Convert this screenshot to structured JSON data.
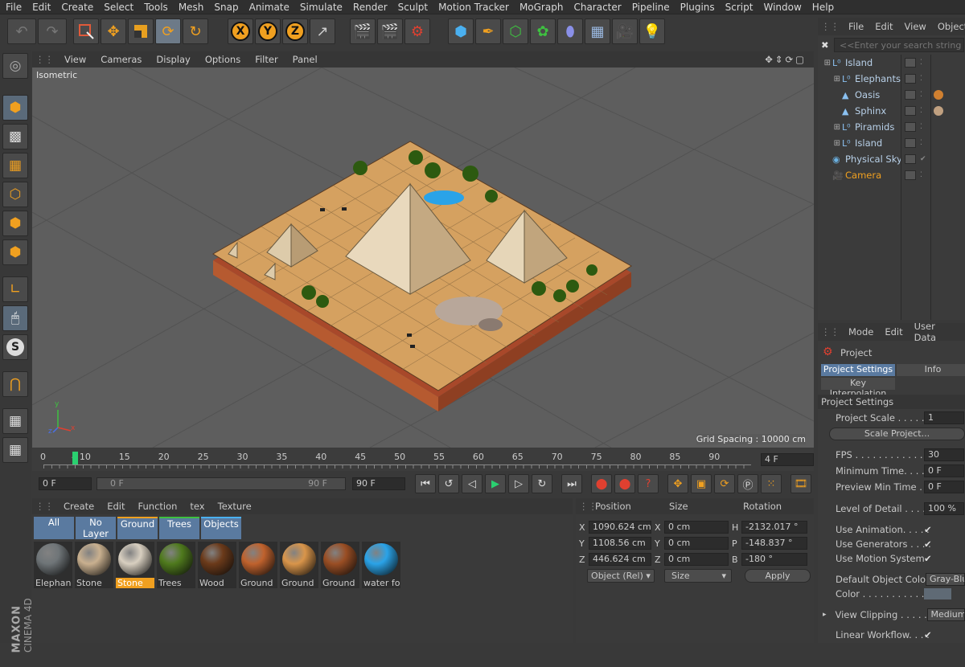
{
  "menubar": {
    "items": [
      "File",
      "Edit",
      "Create",
      "Select",
      "Tools",
      "Mesh",
      "Snap",
      "Animate",
      "Simulate",
      "Render",
      "Sculpt",
      "Motion Tracker",
      "MoGraph",
      "Character",
      "Pipeline",
      "Plugins",
      "Script",
      "Window",
      "Help"
    ]
  },
  "toolbar": {
    "undo_icon": "undo-icon",
    "redo_icon": "redo-icon",
    "tools": [
      "live-selection-icon",
      "move-icon",
      "scale-icon",
      "rotate-icon",
      "recent-tool-icon",
      "x-axis-icon",
      "y-axis-icon",
      "z-axis-icon",
      "coordinate-system-icon",
      "render-view-icon",
      "render-picture-viewer-icon",
      "edit-render-settings-icon",
      "cube-icon",
      "pen-icon",
      "subdivision-icon",
      "cloner-icon",
      "deformer-icon",
      "floor-icon",
      "camera-icon",
      "light-icon"
    ],
    "axis_labels": [
      "X",
      "Y",
      "Z"
    ]
  },
  "left_toolbar": {
    "icons": [
      "make-editable-icon",
      "model-mode-icon",
      "texture-mode-icon",
      "workplane-icon",
      "points-mode-icon",
      "edges-mode-icon",
      "polygons-mode-icon",
      "axis-mode-icon",
      "tweak-mode-icon",
      "solo-icon",
      "magnet-icon",
      "locked-workplane-icon",
      "snap-icon"
    ],
    "solo_label": "S"
  },
  "viewport": {
    "menu": [
      "View",
      "Cameras",
      "Display",
      "Options",
      "Filter",
      "Panel"
    ],
    "label": "Isometric",
    "grid_spacing": "Grid Spacing : 10000 cm",
    "axis_labels": [
      "y",
      "x",
      "z"
    ]
  },
  "timeline": {
    "ticks": [
      "0",
      "4",
      "10",
      "15",
      "20",
      "25",
      "30",
      "35",
      "40",
      "45",
      "50",
      "55",
      "60",
      "65",
      "70",
      "75",
      "80",
      "85",
      "90"
    ],
    "current_frame": "4 F"
  },
  "transport": {
    "start": "0 F",
    "range_start": "0 F",
    "range_end": "90 F",
    "end": "90 F"
  },
  "material_manager": {
    "menu": [
      "Create",
      "Edit",
      "Function",
      "tex",
      "Texture"
    ],
    "filters": [
      "All",
      "No Layer",
      "Ground",
      "Trees",
      "Objects"
    ],
    "materials": [
      {
        "name": "Elephan",
        "color": "#6f7578"
      },
      {
        "name": "Stone",
        "color": "#c9b08f"
      },
      {
        "name": "Stone",
        "color": "#d8cfc0",
        "selected": true
      },
      {
        "name": "Trees",
        "color": "#4f7a1d"
      },
      {
        "name": "Wood",
        "color": "#6b3a1a"
      },
      {
        "name": "Ground",
        "color": "#c0622d"
      },
      {
        "name": "Ground",
        "color": "#d9954a"
      },
      {
        "name": "Ground",
        "color": "#9a4e24"
      },
      {
        "name": "water fo",
        "color": "#2aa3e8"
      }
    ],
    "brand": "MAXON",
    "product": "CINEMA 4D"
  },
  "coordinates": {
    "headers": [
      "Position",
      "Size",
      "Rotation"
    ],
    "rows": [
      {
        "axis": "X",
        "pos": "1090.624 cm",
        "size_axis": "X",
        "size": "0 cm",
        "rot_axis": "H",
        "rot": "-2132.017 °"
      },
      {
        "axis": "Y",
        "pos": "1108.56 cm",
        "size_axis": "Y",
        "size": "0 cm",
        "rot_axis": "P",
        "rot": "-148.837 °"
      },
      {
        "axis": "Z",
        "pos": "446.624 cm",
        "size_axis": "Z",
        "size": "0 cm",
        "rot_axis": "B",
        "rot": "-180 °"
      }
    ],
    "mode": "Object (Rel)",
    "size_mode": "Size",
    "apply": "Apply"
  },
  "object_manager": {
    "menu": [
      "File",
      "Edit",
      "View",
      "Objects"
    ],
    "search_placeholder": "<<Enter your search string here>>",
    "objects": [
      {
        "name": "Island",
        "indent": 0
      },
      {
        "name": "Elephants",
        "indent": 1
      },
      {
        "name": "Oasis",
        "indent": 1
      },
      {
        "name": "Sphinx",
        "indent": 1
      },
      {
        "name": "Piramids",
        "indent": 1
      },
      {
        "name": "Island",
        "indent": 1
      },
      {
        "name": "Physical Sky",
        "indent": 0
      },
      {
        "name": "Camera",
        "indent": 0,
        "highlight": true
      }
    ]
  },
  "attribute_manager": {
    "menu": [
      "Mode",
      "Edit",
      "User Data"
    ],
    "title": "Project",
    "tabs": [
      "Project Settings",
      "Info",
      "Key Interpolation"
    ],
    "section": "Project Settings",
    "fields": {
      "project_scale_label": "Project Scale . . . . . .",
      "project_scale": "1",
      "scale_button": "Scale Project...",
      "fps_label": "FPS . . . . . . . . . . . . . .",
      "fps": "30",
      "min_time_label": "Minimum Time. . . . . .",
      "min_time": "0 F",
      "preview_min_label": "Preview Min Time . . .",
      "preview_min": "0 F",
      "lod_label": "Level of Detail . . . . .",
      "lod": "100 %",
      "use_anim_label": "Use Animation. . . . .",
      "use_gen_label": "Use Generators . . . .",
      "use_motion_label": "Use Motion System",
      "default_color_label": "Default Object Color",
      "default_color": "Gray-Blue",
      "color_label": "Color . . . . . . . . . . .",
      "view_clip_label": "View Clipping . . . . .",
      "view_clip": "Medium",
      "linear_label": "Linear Workflow. . . ."
    }
  }
}
